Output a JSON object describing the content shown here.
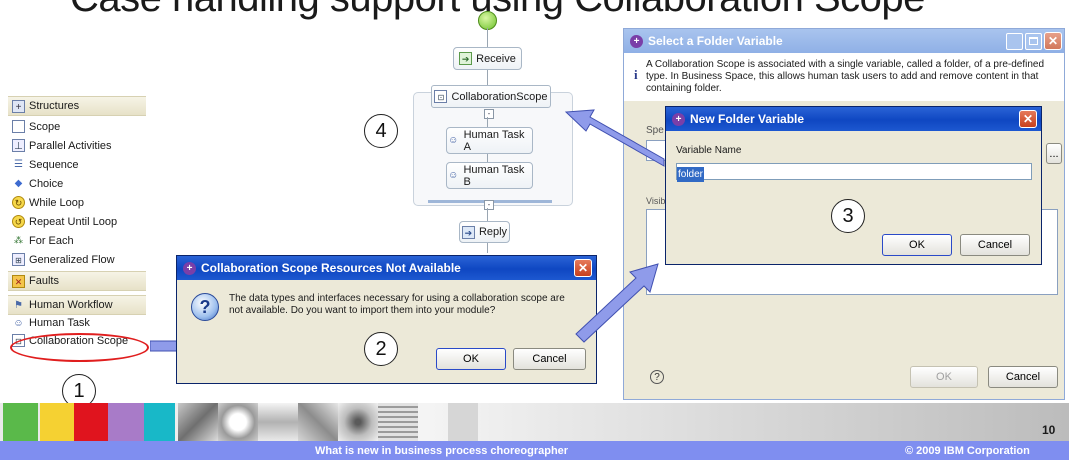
{
  "slide": {
    "title": "Case handling support using Collaboration Scope",
    "page_number": "10",
    "footer_left": "What is new in business process choreographer",
    "footer_right": "© 2009 IBM Corporation"
  },
  "palette": {
    "structures_header": "Structures",
    "items": [
      "Scope",
      "Parallel Activities",
      "Sequence",
      "Choice",
      "While Loop",
      "Repeat Until Loop",
      "For Each",
      "Generalized Flow"
    ],
    "faults_header": "Faults",
    "workflow_header": "Human Workflow",
    "human_task": "Human Task",
    "collab_scope": "Collaboration Scope"
  },
  "process": {
    "receive": "Receive",
    "scope": "CollaborationScope",
    "task_a": "Human Task A",
    "task_b": "Human Task B",
    "reply": "Reply"
  },
  "callouts": [
    "1",
    "2",
    "3",
    "4"
  ],
  "resources_dialog": {
    "title": "Collaboration Scope Resources Not Available",
    "message": "The data types and interfaces necessary for using a collaboration scope are not available. Do you want to import them into your module?",
    "ok": "OK",
    "cancel": "Cancel"
  },
  "folder_dialog": {
    "title": "Select a Folder Variable",
    "info": "A Collaboration Scope is associated with a single variable, called a folder, of a pre-defined type. In Business Space, this allows human task users to add and remove content in that containing folder.",
    "spec_label_partial": "Spe",
    "visible_label_partial": "Visib",
    "browse": "...",
    "ok": "OK",
    "cancel": "Cancel"
  },
  "new_var_dialog": {
    "title": "New Folder Variable",
    "label": "Variable Name",
    "value": "folder",
    "ok": "OK",
    "cancel": "Cancel"
  },
  "colors": {
    "xp_blue": "#0f47c2",
    "dialog_bg": "#ece9d8",
    "callout_red": "#e01e1e",
    "arrow_blue": "#8f9bea"
  }
}
